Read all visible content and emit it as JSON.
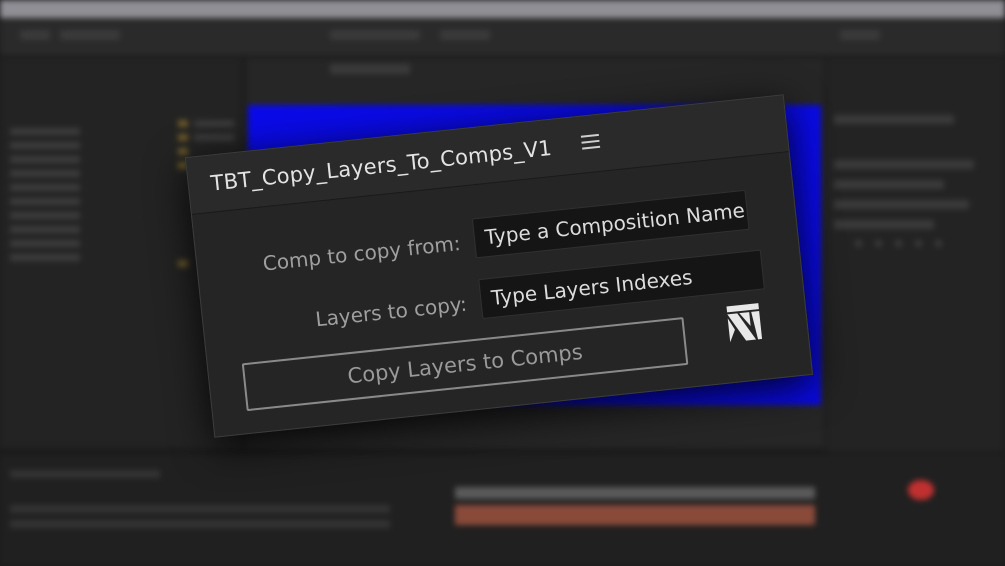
{
  "panel": {
    "title": "TBT_Copy_Layers_To_Comps_V1",
    "menu_icon": "hamburger-menu-icon",
    "comp_from_label": "Comp to copy from:",
    "comp_from_placeholder": "Type a Composition Name",
    "layers_label": "Layers to copy:",
    "layers_placeholder": "Type Layers Indexes",
    "run_button_label": "Copy Layers to Comps",
    "logo_icon": "tbt-logo-icon"
  },
  "colors": {
    "panel_bg": "#252525",
    "field_bg": "#151515",
    "comp_canvas": "#0a0ae8",
    "text_primary": "#e3e3e3",
    "text_label": "#9f9f9f"
  }
}
